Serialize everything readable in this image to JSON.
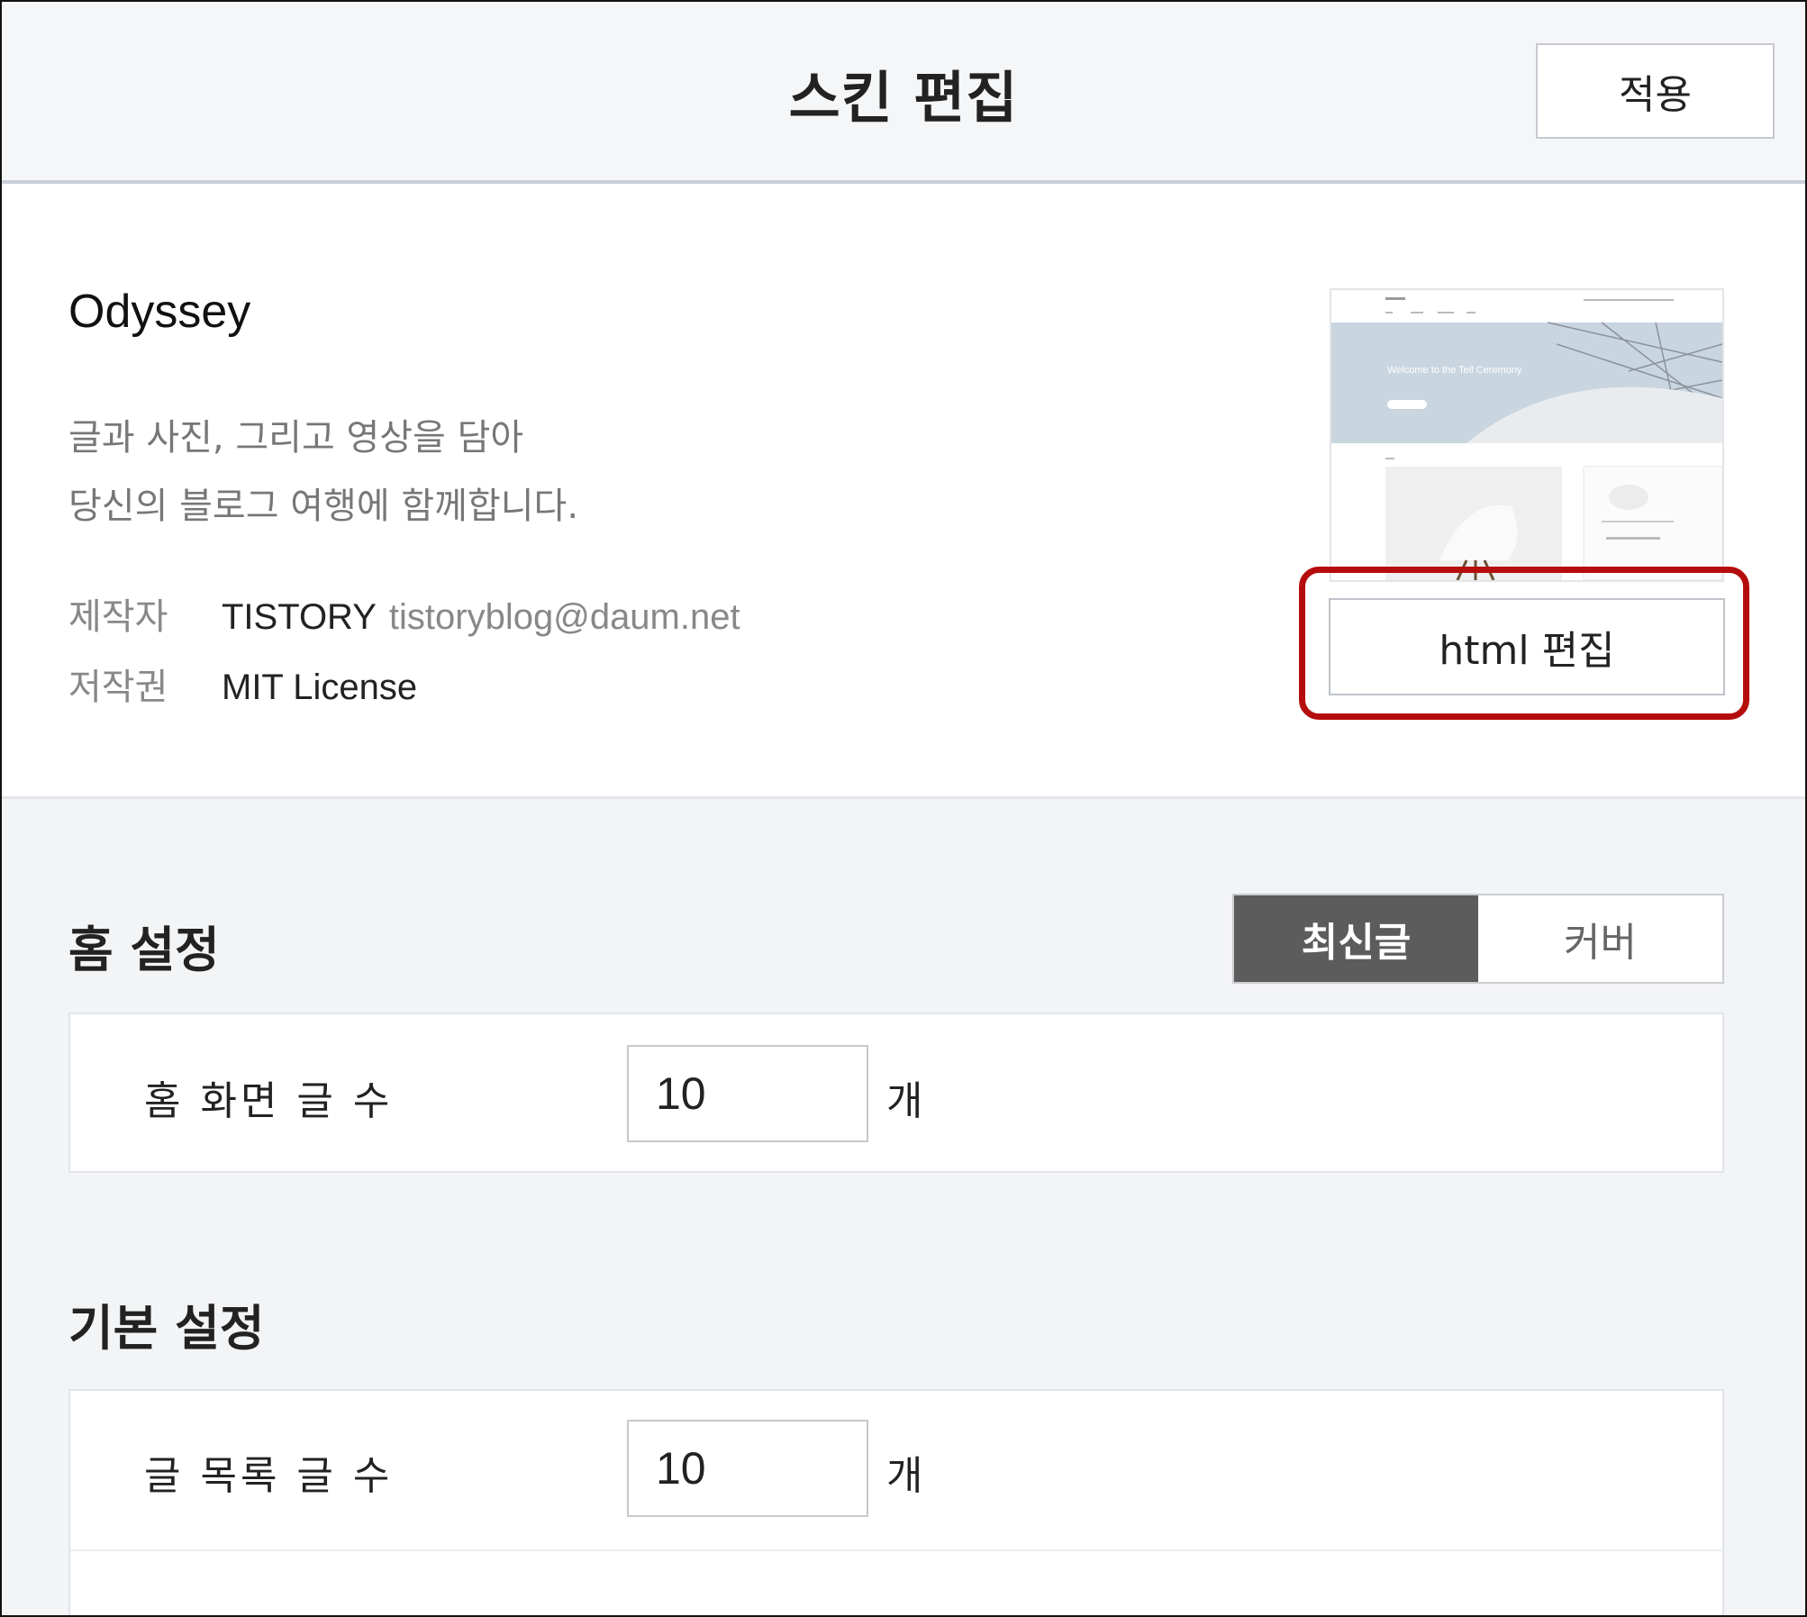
{
  "header": {
    "title": "스킨 편집",
    "apply_label": "적용"
  },
  "skin": {
    "name": "Odyssey",
    "description_line1": "글과 사진, 그리고 영상을 담아",
    "description_line2": "당신의 블로그 여행에 함께합니다.",
    "author_label": "제작자",
    "author_name": "TISTORY",
    "author_email": "tistoryblog@daum.net",
    "license_label": "저작권",
    "license_value": "MIT License",
    "preview_banner": "Welcome to the Tell Ceremony",
    "html_edit_label": "html 편집"
  },
  "home_settings": {
    "title": "홈 설정",
    "toggle_options": [
      "최신글",
      "커버"
    ],
    "selected_option": "최신글",
    "post_count_label": "홈 화면 글 수",
    "post_count_value": "10",
    "unit": "개"
  },
  "basic_settings": {
    "title": "기본 설정",
    "list_count_label": "글 목록 글 수",
    "list_count_value": "10",
    "unit": "개"
  },
  "colors": {
    "highlight": "#b50d0d",
    "toggle_active_bg": "#5c5c5c",
    "page_bg": "#f3f4f6"
  }
}
